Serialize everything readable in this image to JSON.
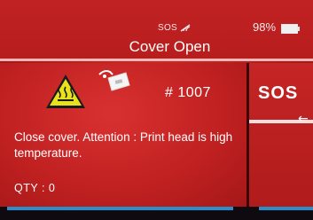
{
  "status_bar": {
    "sos_indicator": "SOS",
    "signal_icon": "signal-icon",
    "battery_percent": "98%",
    "battery_icon": "battery-icon"
  },
  "header": {
    "title": "Cover Open"
  },
  "alert": {
    "warning_icon": "hot-surface-warning-icon",
    "cover_icon": "open-cover-icon",
    "code": "# 1007",
    "message": "Close cover. Attention : Print head is high temperature.",
    "qty_label": "QTY : 0"
  },
  "side_panel": {
    "sos_label": "SOS",
    "arrow_icon": "arrow-left-icon"
  },
  "colors": {
    "background_red": "#c22424",
    "accent_blue": "#2a8ec8",
    "warning_yellow": "#e8e21a"
  }
}
